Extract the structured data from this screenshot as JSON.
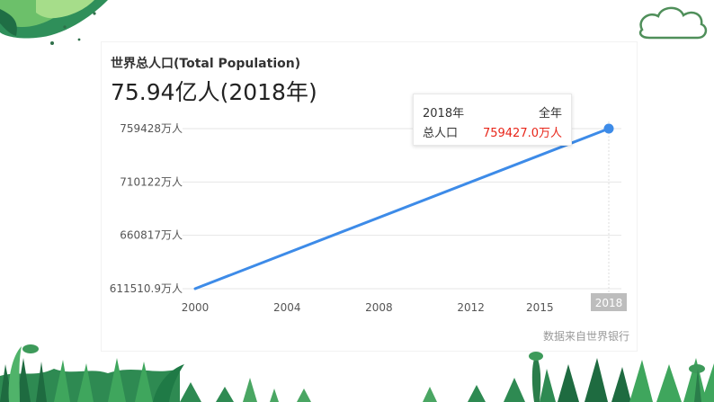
{
  "chart_data": {
    "type": "line",
    "title": "世界总人口(Total Population)",
    "headline": "75.94亿人(2018年)",
    "unit_suffix": "万人",
    "x": [
      2000,
      2018
    ],
    "x_tick_labels": [
      "2000",
      "2004",
      "2008",
      "2012",
      "2015",
      "2018"
    ],
    "x_tick_values": [
      2000,
      2004,
      2008,
      2012,
      2015,
      2018
    ],
    "y_tick_labels": [
      "759428万人",
      "710122万人",
      "660817万人",
      "611510.9万人"
    ],
    "y_tick_values": [
      759428,
      710122,
      660817,
      611510.9
    ],
    "series": [
      {
        "values": [
          611510.9,
          759427.0
        ]
      }
    ],
    "xlim": [
      2000,
      2018
    ],
    "ylim": [
      611510.9,
      759428
    ],
    "grid": true,
    "colors": {
      "line": "#3d8be8",
      "grid": "#e6e6e6",
      "axis_text": "#555555",
      "highlight_label_bg": "#bdbdbd"
    },
    "tooltip": {
      "date": "2018年",
      "period": "全年",
      "label": "总人口",
      "value": "759427.0万人"
    },
    "source_note": "数据来自世界银行"
  }
}
